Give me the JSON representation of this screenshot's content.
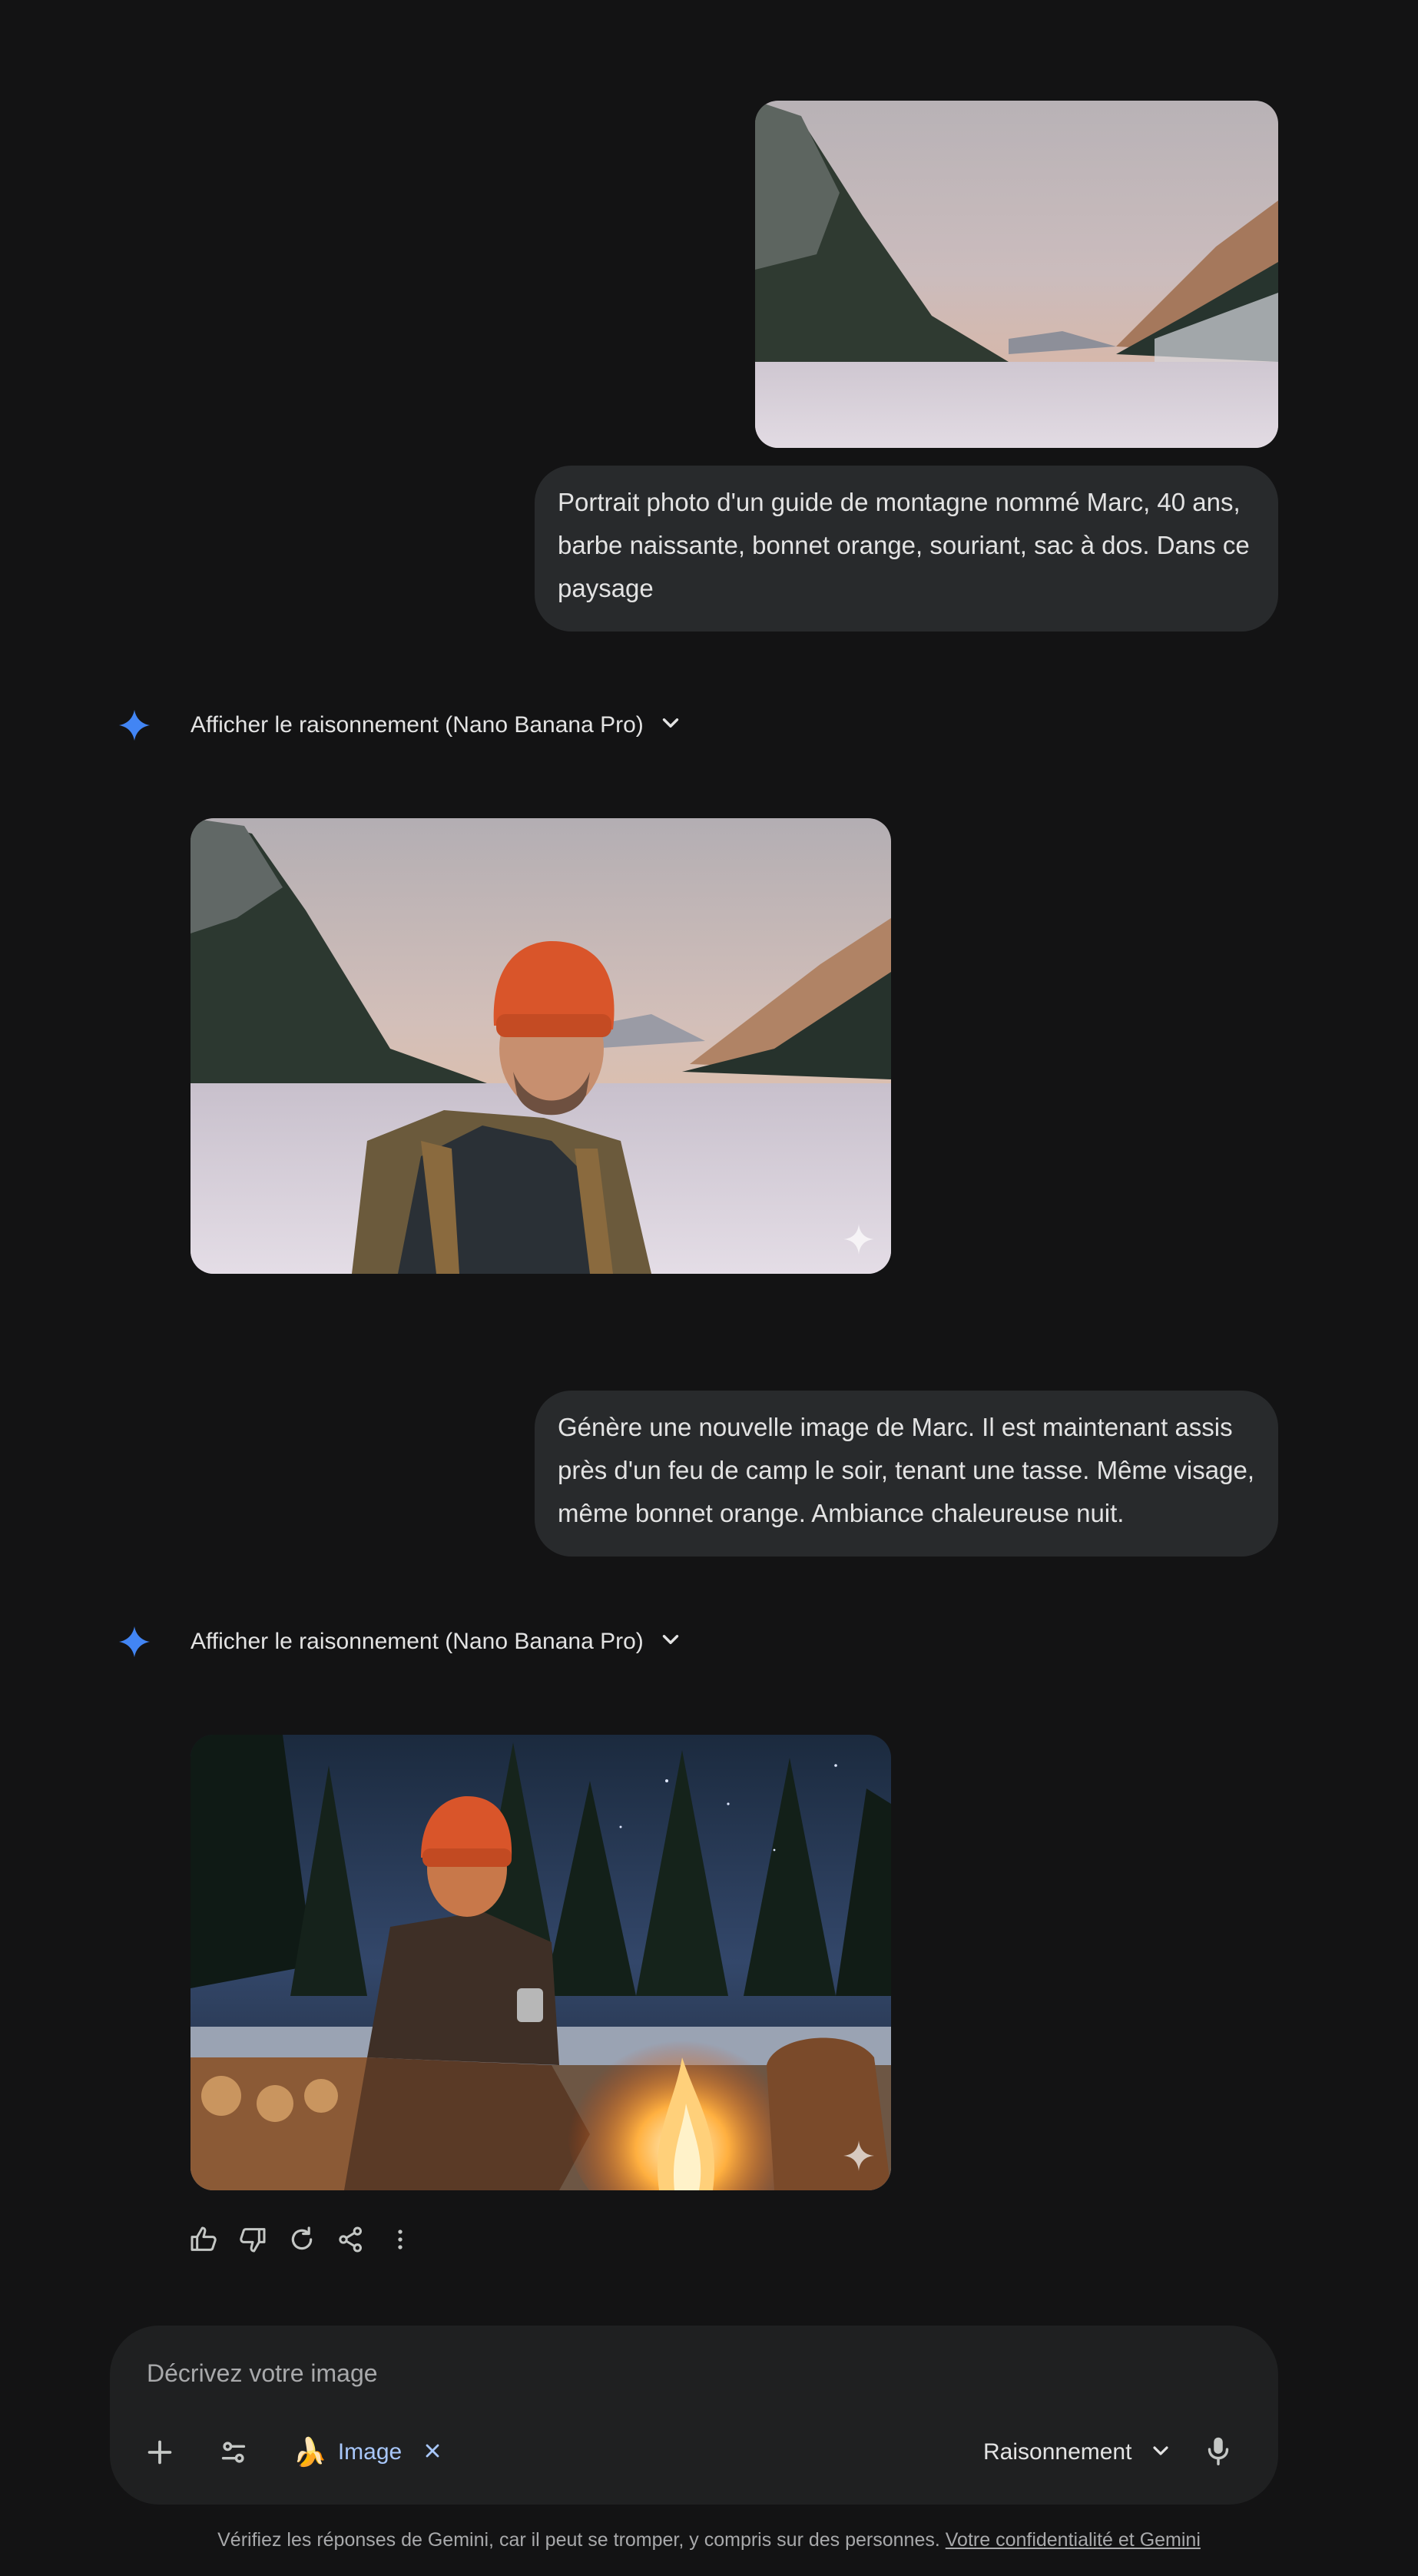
{
  "conversation": {
    "turn1": {
      "user_text": "Portrait photo d'un guide de montagne nommé Marc, 40 ans, barbe naissante, bonnet orange, souriant, sac à dos. Dans ce paysage"
    },
    "response1": {
      "reasoning_label": "Afficher le raisonnement (Nano Banana Pro)"
    },
    "turn2": {
      "user_text": "Génère une nouvelle image de Marc. Il est maintenant assis près d'un feu de camp le soir, tenant une tasse. Même visage, même bonnet orange. Ambiance chaleureuse nuit."
    },
    "response2": {
      "reasoning_label": "Afficher le raisonnement (Nano Banana Pro)"
    }
  },
  "composer": {
    "placeholder": "Décrivez votre image",
    "tool_chip_label": "Image",
    "tool_chip_emoji": "🍌",
    "mode_label": "Raisonnement"
  },
  "footer": {
    "disclaimer": "Vérifiez les réponses de Gemini, car il peut se tromper, y compris sur des personnes.",
    "privacy_link": "Votre confidentialité et Gemini"
  },
  "colors": {
    "background": "#131314",
    "bubble": "#282a2c",
    "accent_blue": "#4285f4",
    "chip_text": "#a8c7fa"
  }
}
